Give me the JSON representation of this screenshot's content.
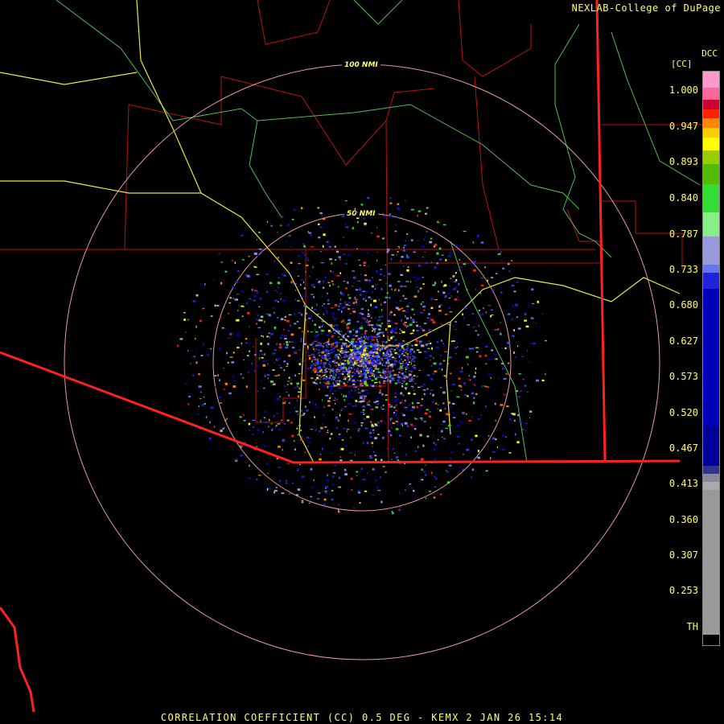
{
  "credit": "NEXLAB-College of DuPage",
  "footer": "CORRELATION COEFFICIENT (CC) 0.5 DEG - KEMX 2 JAN 26 15:14",
  "legend": {
    "product": "DCC",
    "units": "[CC]",
    "labels": [
      "1.000",
      "0.947",
      "0.893",
      "0.840",
      "0.787",
      "0.733",
      "0.680",
      "0.627",
      "0.573",
      "0.520",
      "0.467",
      "0.413",
      "0.360",
      "0.307",
      "0.253",
      "TH"
    ],
    "colors": [
      "#ff99cc",
      "#ff6699",
      "#cc0033",
      "#ff2200",
      "#ff8800",
      "#ffcc00",
      "#ffff00",
      "#99cc00",
      "#55bb00",
      "#33dd33",
      "#88ee88",
      "#9999dd",
      "#6677ee",
      "#2222dd",
      "#0000bb",
      "#000099",
      "#333388",
      "#888899",
      "#aaaaaa",
      "#999999",
      "#000000"
    ]
  },
  "range_rings": [
    {
      "label": "100 NMI",
      "nmi": 100
    },
    {
      "label": "50 NMI",
      "nmi": 50
    }
  ],
  "colors": {
    "state_border": "#ff2020",
    "county_border": "#cc1111",
    "highway": "#e8e840",
    "river": "#66cc66",
    "ring": "#e89a9a"
  }
}
